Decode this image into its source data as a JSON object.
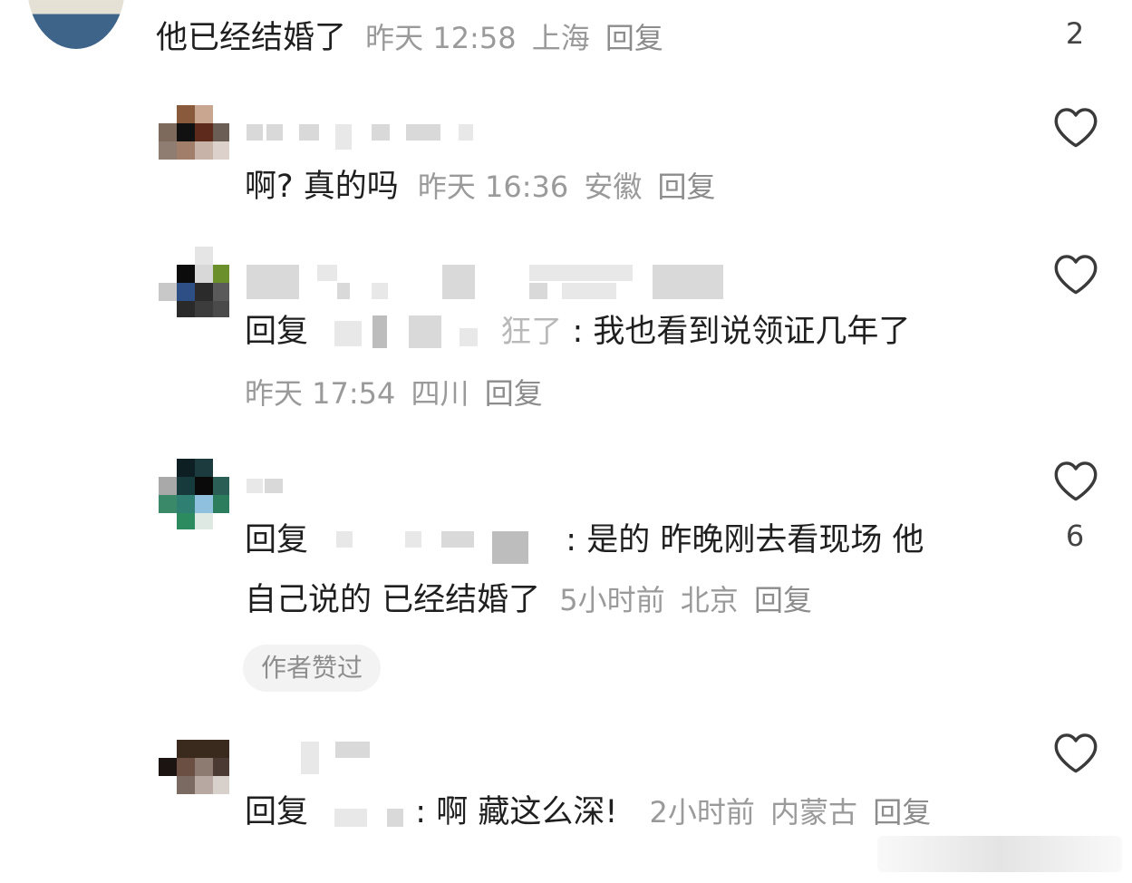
{
  "comments": [
    {
      "text": "他已经结婚了",
      "time": "昨天 12:58",
      "location": "上海",
      "reply_label": "回复",
      "like_count": "2"
    },
    {
      "text": "啊? 真的吗",
      "time": "昨天 16:36",
      "location": "安徽",
      "reply_label": "回复"
    },
    {
      "reply_prefix": "回复",
      "partial_name": "狂了",
      "text": ": 我也看到说领证几年了",
      "time": "昨天 17:54",
      "location": "四川",
      "reply_label": "回复"
    },
    {
      "reply_prefix": "回复",
      "text_line1": ": 是的 昨晚刚去看现场 他",
      "text_line2": "自己说的 已经结婚了",
      "time": "5小时前",
      "location": "北京",
      "reply_label": "回复",
      "like_count": "6",
      "badge": "作者赞过"
    },
    {
      "reply_prefix": "回复",
      "text": ": 啊 藏这么深!",
      "time": "2小时前",
      "location": "内蒙古",
      "reply_label": "回复"
    }
  ],
  "icons": [
    "heart-outline-icon"
  ],
  "colors": {
    "meta_text": "#9a9a9a",
    "main_text": "#1f1f1f",
    "badge_bg": "#f3f3f3"
  }
}
